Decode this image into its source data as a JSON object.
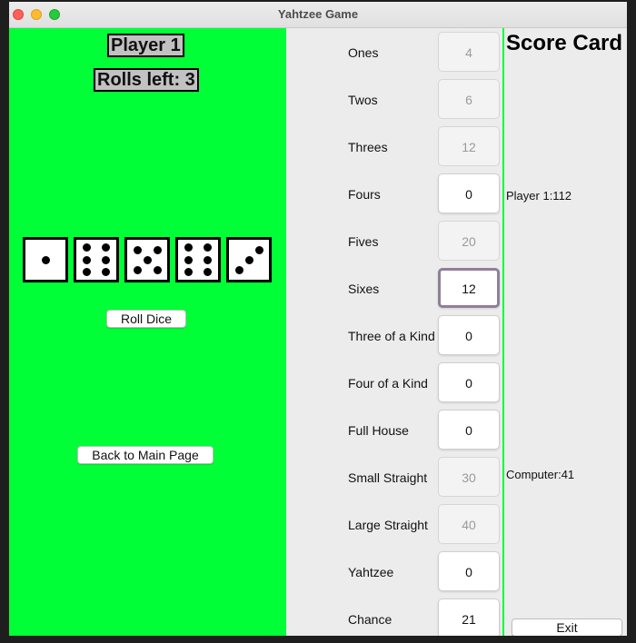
{
  "window": {
    "title": "Yahtzee Game"
  },
  "left": {
    "player_label": "Player 1",
    "rolls_label": "Rolls left: 3",
    "dice": [
      1,
      6,
      5,
      6,
      3
    ],
    "roll_button": "Roll Dice",
    "back_button": "Back to Main Page"
  },
  "categories": [
    {
      "label": "Ones",
      "value": "4",
      "state": "filled"
    },
    {
      "label": "Twos",
      "value": "6",
      "state": "filled"
    },
    {
      "label": "Threes",
      "value": "12",
      "state": "filled"
    },
    {
      "label": "Fours",
      "value": "0",
      "state": "open"
    },
    {
      "label": "Fives",
      "value": "20",
      "state": "filled"
    },
    {
      "label": "Sixes",
      "value": "12",
      "state": "focused"
    },
    {
      "label": "Three of a Kind",
      "value": "0",
      "state": "open"
    },
    {
      "label": "Four of a Kind",
      "value": "0",
      "state": "open"
    },
    {
      "label": "Full House",
      "value": "0",
      "state": "open"
    },
    {
      "label": "Small Straight",
      "value": "30",
      "state": "filled"
    },
    {
      "label": "Large Straight",
      "value": "40",
      "state": "filled"
    },
    {
      "label": "Yahtzee",
      "value": "0",
      "state": "open"
    },
    {
      "label": "Chance",
      "value": "21",
      "state": "open"
    }
  ],
  "scorecard": {
    "title": "Score Card",
    "player_score": "Player 1:112",
    "computer_score": "Computer:41",
    "exit_button": "Exit"
  },
  "colors": {
    "left_panel": "#00ff37",
    "accent_focus": "#8e7f9a"
  }
}
